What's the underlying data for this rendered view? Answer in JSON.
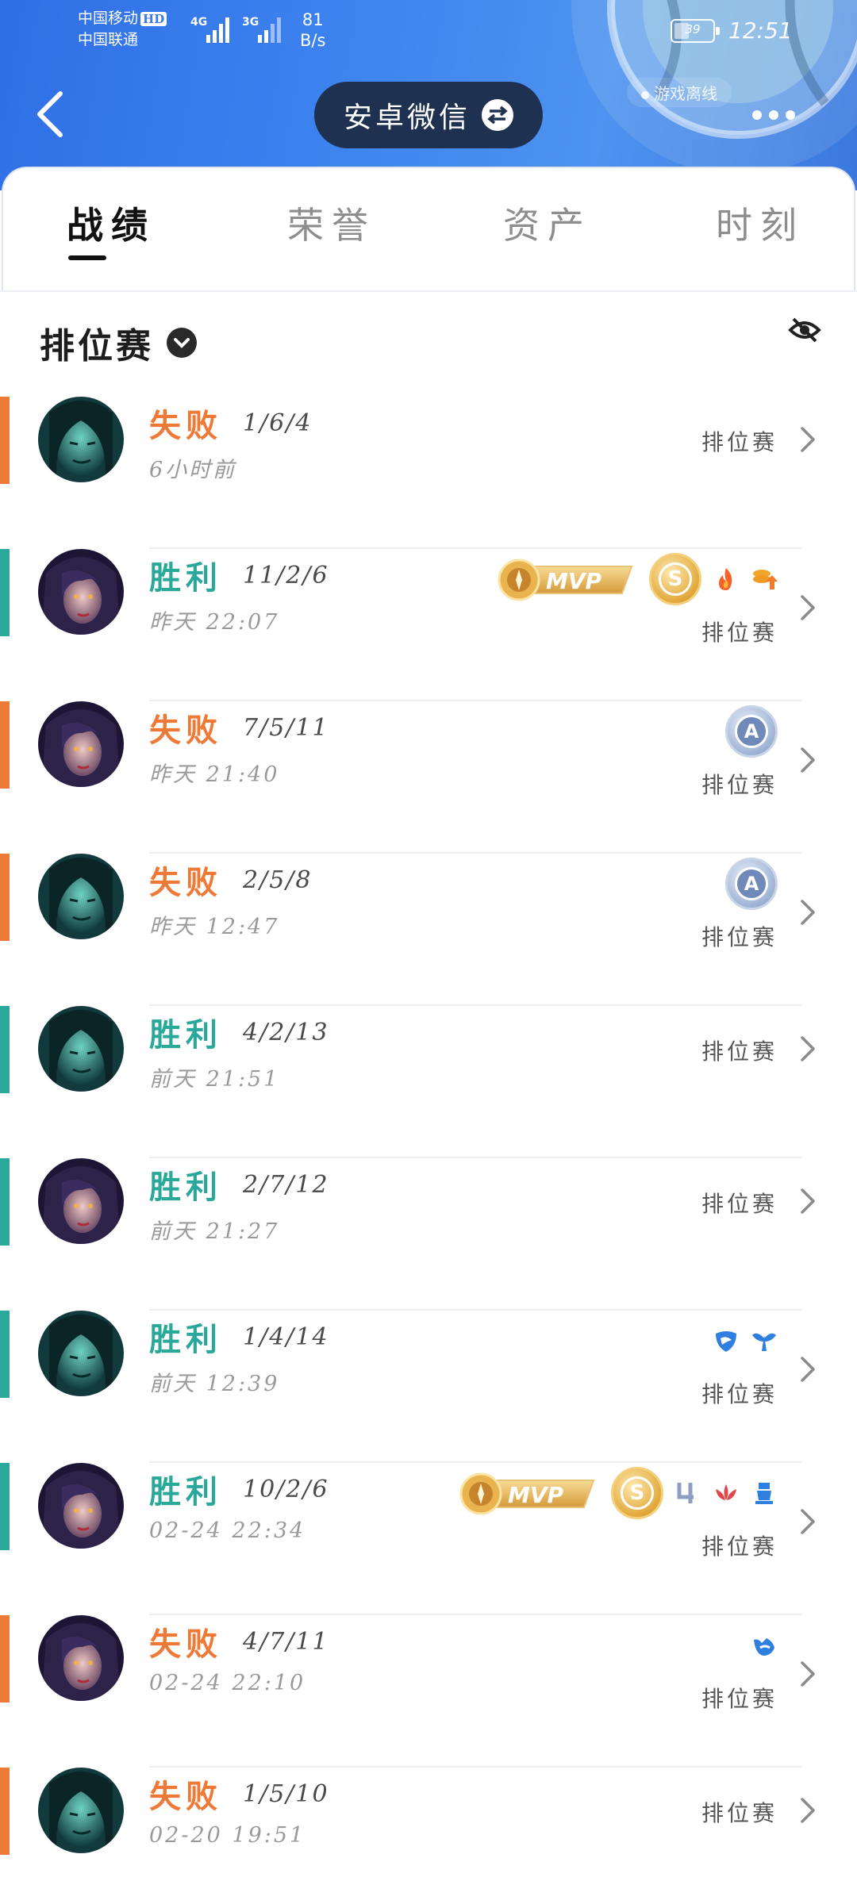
{
  "status_bar": {
    "carrier1": "中国移动",
    "carrier1_badge": "HD",
    "carrier2": "中国联通",
    "sig1_label": "4G",
    "sig2_label": "3G",
    "speed_value": "81",
    "speed_unit": "B/s",
    "battery": "39",
    "battery_level": 0.39,
    "time": "12:51"
  },
  "header": {
    "title": "安卓微信",
    "offline_text": "游戏离线",
    "colors": {
      "gradient_start": "#2f6fe6",
      "gradient_end": "#3a78de",
      "pill": "#1f3150"
    }
  },
  "tabs": [
    {
      "label": "战绩",
      "active": true
    },
    {
      "label": "荣誉",
      "active": false
    },
    {
      "label": "资产",
      "active": false
    },
    {
      "label": "时刻",
      "active": false
    }
  ],
  "filter": {
    "label": "排位赛"
  },
  "colors": {
    "win": "#2aa99a",
    "loss": "#ee7a37"
  },
  "matches": [
    {
      "result": "失败",
      "outcome": "loss",
      "kda": "1/6/4",
      "time": "6小时前",
      "mode": "排位赛",
      "hero": "teal",
      "badges": []
    },
    {
      "result": "胜利",
      "outcome": "win",
      "kda": "11/2/6",
      "time": "昨天 22:07",
      "mode": "排位赛",
      "hero": "purple",
      "badges": [
        "mvp-gold",
        "s-rating",
        "fire-icon",
        "coin-up-icon"
      ]
    },
    {
      "result": "失败",
      "outcome": "loss",
      "kda": "7/5/11",
      "time": "昨天 21:40",
      "mode": "排位赛",
      "hero": "purple",
      "badges": [
        "a-rating"
      ]
    },
    {
      "result": "失败",
      "outcome": "loss",
      "kda": "2/5/8",
      "time": "昨天 12:47",
      "mode": "排位赛",
      "hero": "teal",
      "badges": [
        "a-rating"
      ]
    },
    {
      "result": "胜利",
      "outcome": "win",
      "kda": "4/2/13",
      "time": "前天 21:51",
      "mode": "排位赛",
      "hero": "teal",
      "badges": []
    },
    {
      "result": "胜利",
      "outcome": "win",
      "kda": "2/7/12",
      "time": "前天 21:27",
      "mode": "排位赛",
      "hero": "purple",
      "badges": []
    },
    {
      "result": "胜利",
      "outcome": "win",
      "kda": "1/4/14",
      "time": "前天 12:39",
      "mode": "排位赛",
      "hero": "teal",
      "badges": [
        "shield-icon",
        "wings-icon"
      ]
    },
    {
      "result": "胜利",
      "outcome": "win",
      "kda": "10/2/6",
      "time": "02-24 22:34",
      "mode": "排位赛",
      "hero": "purple",
      "badges": [
        "mvp-gold",
        "s-rating",
        "quadra-icon",
        "lotus-icon",
        "tower-icon"
      ]
    },
    {
      "result": "失败",
      "outcome": "loss",
      "kda": "4/7/11",
      "time": "02-24 22:10",
      "mode": "排位赛",
      "hero": "purple",
      "badges": [
        "guard-icon"
      ]
    },
    {
      "result": "失败",
      "outcome": "loss",
      "kda": "1/5/10",
      "time": "02-20 19:51",
      "mode": "排位赛",
      "hero": "teal",
      "badges": []
    }
  ]
}
